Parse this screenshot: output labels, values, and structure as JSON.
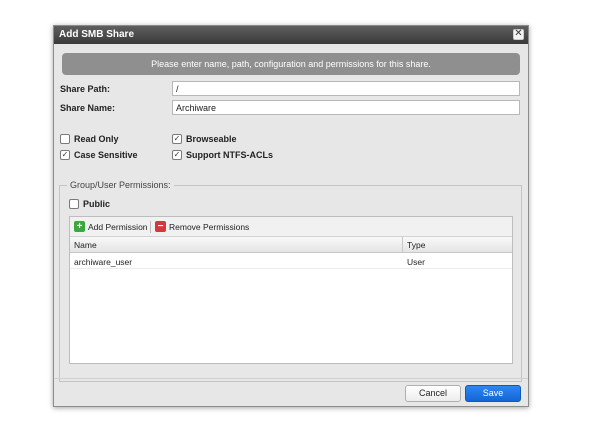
{
  "dialog": {
    "title": "Add SMB Share",
    "close_glyph": "✕",
    "banner": "Please enter name, path, configuration and permissions for this share."
  },
  "fields": {
    "share_path_label": "Share Path:",
    "share_path_value": "/",
    "share_name_label": "Share Name:",
    "share_name_value": "Archiware"
  },
  "options": {
    "read_only": {
      "label": "Read Only",
      "checked": false
    },
    "case_sensitive": {
      "label": "Case Sensitive",
      "checked": true
    },
    "browseable": {
      "label": "Browseable",
      "checked": true
    },
    "ntfs_acls": {
      "label": "Support NTFS-ACLs",
      "checked": true
    },
    "check_glyph": "✓"
  },
  "permissions": {
    "legend": "Group/User Permissions:",
    "public": {
      "label": "Public",
      "checked": false
    },
    "add_label": "Add Permission",
    "remove_label": "Remove Permissions",
    "add_glyph": "+",
    "remove_glyph": "−",
    "columns": [
      "Name",
      "Type"
    ],
    "rows": [
      {
        "name": "archiware_user",
        "type": "User"
      }
    ]
  },
  "footer": {
    "cancel_label": "Cancel",
    "save_label": "Save"
  },
  "colors": {
    "title_bar": "#3a3a3a",
    "banner": "#8f8f8f",
    "save_button": "#1366d6",
    "add_icon": "#3aa83a",
    "remove_icon": "#d23a3a"
  },
  "icons": {
    "close": "close-icon",
    "check": "check-icon",
    "add": "add-icon",
    "remove": "remove-icon"
  }
}
